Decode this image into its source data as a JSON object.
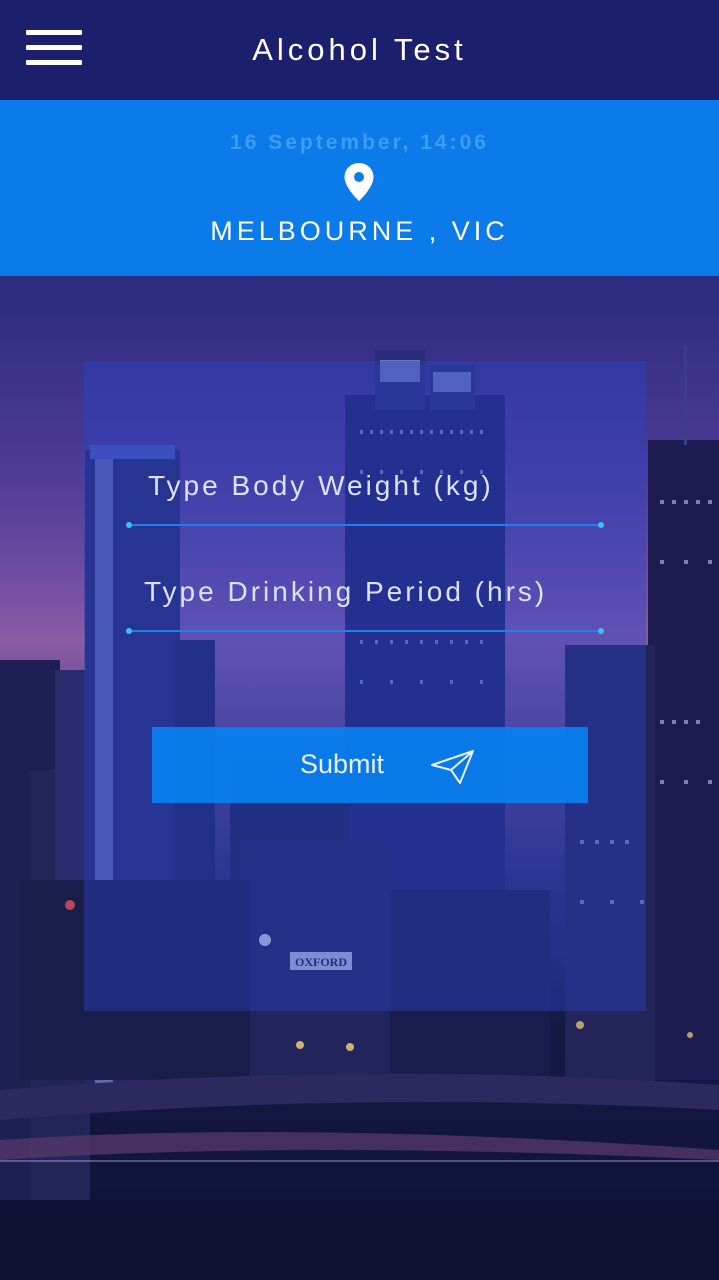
{
  "app": {
    "title": "Alcohol Test",
    "menu_icon": "hamburger-menu-icon"
  },
  "info": {
    "date_time": "16 September, 14:06",
    "location_icon": "location-pin-icon",
    "location": "MELBOURNE , VIC"
  },
  "form": {
    "body_weight_placeholder": "Type Body Weight (kg)",
    "body_weight_value": "",
    "drinking_period_placeholder": "Type Drinking Period (hrs)",
    "drinking_period_value": "",
    "submit_label": "Submit",
    "submit_icon": "paper-plane-send-icon"
  },
  "background": {
    "sign_text": "OXFORD"
  },
  "colors": {
    "top_bar": "#1c1f6b",
    "info_band": "#0a7be8",
    "date_text": "#3d9cf3",
    "card": "rgba(40,70,200,0.42)",
    "button": "#0880f0",
    "field_underline": "#1f7ff0"
  }
}
